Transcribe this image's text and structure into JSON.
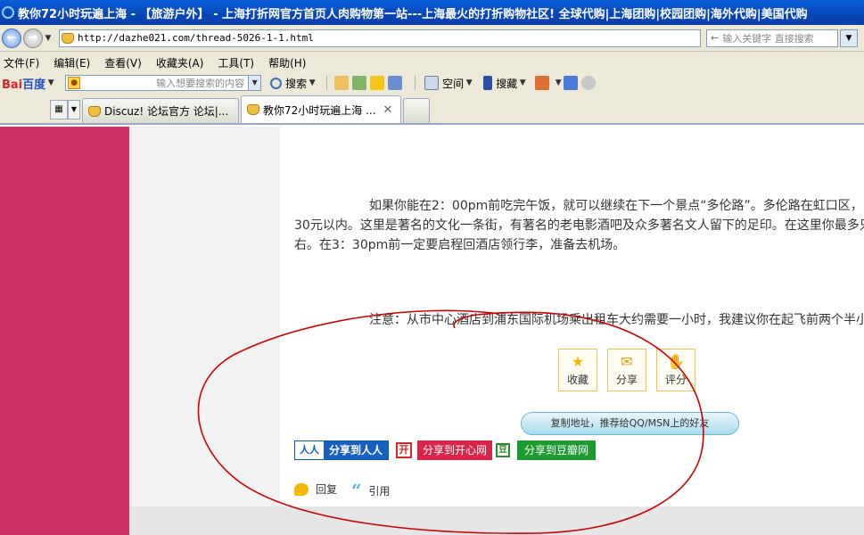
{
  "window": {
    "title": "教你72小时玩遍上海 - 【旅游户外】 - 上海打折网官方首页人肉购物第一站---上海最火的打折购物社区! 全球代购|上海团购|校园团购|海外代购|美国代购"
  },
  "address_bar": {
    "url": "http://dazhe021.com/thread-5026-1-1.html",
    "search_placeholder": "输入关键字 直接搜索"
  },
  "menu": [
    "文件(F)",
    "编辑(E)",
    "查看(V)",
    "收藏夹(A)",
    "工具(T)",
    "帮助(H)"
  ],
  "baidu_toolbar": {
    "logo_a": "Bai",
    "logo_b": "百度",
    "input_placeholder": "输入想要搜索的内容",
    "search_label": "搜索",
    "space_label": "空间",
    "soucang_label": "搜藏"
  },
  "tabs": [
    {
      "label": "Discuz! 论坛官方 论坛|...",
      "active": false
    },
    {
      "label": "教你72小时玩遍上海 ...",
      "active": true
    }
  ],
  "post": {
    "paragraph_lines": [
      "如果你能在2：00pm前吃完午饭，就可以继续在下一个景点“多伦路”。多伦路在虹口区，",
      "30元以内。这里是著名的文化一条街，有著名的老电影酒吧及众多著名文人留下的足印。在这里你最多只",
      "右。在3：30pm前一定要启程回酒店领行李，准备去机场。"
    ],
    "note": "注意：从市中心酒店到浦东国际机场乘出租车大约需要一小时，我建议你在起飞前两个半小"
  },
  "actions": {
    "favorite": "收藏",
    "share": "分享",
    "rate": "评分",
    "copy_address": "复制地址，推荐给QQ/MSN上的好友"
  },
  "share_links": {
    "renren": "分享到人人",
    "renren_logo": "人人",
    "kaixin": "分享到开心网",
    "kaixin_logo": "开",
    "douban": "分享到豆瓣网",
    "douban_logo": "豆"
  },
  "post_footer": {
    "reply": "回复",
    "quote": "引用"
  },
  "colors": {
    "sidebar_pink": "#cc3366",
    "annotation_red": "#cc0000"
  }
}
